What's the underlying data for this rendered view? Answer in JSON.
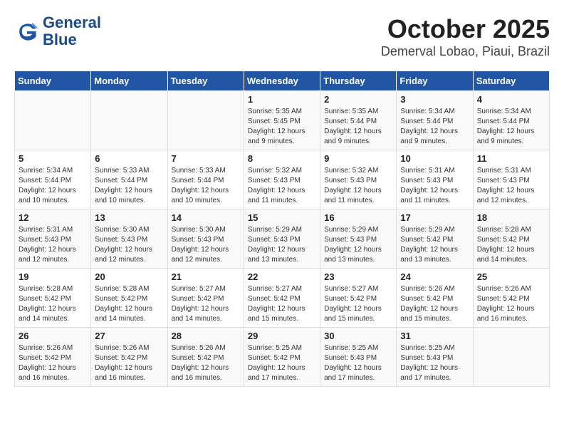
{
  "header": {
    "logo_line1": "General",
    "logo_line2": "Blue",
    "month": "October 2025",
    "location": "Demerval Lobao, Piaui, Brazil"
  },
  "weekdays": [
    "Sunday",
    "Monday",
    "Tuesday",
    "Wednesday",
    "Thursday",
    "Friday",
    "Saturday"
  ],
  "weeks": [
    [
      {
        "day": "",
        "info": ""
      },
      {
        "day": "",
        "info": ""
      },
      {
        "day": "",
        "info": ""
      },
      {
        "day": "1",
        "info": "Sunrise: 5:35 AM\nSunset: 5:45 PM\nDaylight: 12 hours and 9 minutes."
      },
      {
        "day": "2",
        "info": "Sunrise: 5:35 AM\nSunset: 5:44 PM\nDaylight: 12 hours and 9 minutes."
      },
      {
        "day": "3",
        "info": "Sunrise: 5:34 AM\nSunset: 5:44 PM\nDaylight: 12 hours and 9 minutes."
      },
      {
        "day": "4",
        "info": "Sunrise: 5:34 AM\nSunset: 5:44 PM\nDaylight: 12 hours and 9 minutes."
      }
    ],
    [
      {
        "day": "5",
        "info": "Sunrise: 5:34 AM\nSunset: 5:44 PM\nDaylight: 12 hours and 10 minutes."
      },
      {
        "day": "6",
        "info": "Sunrise: 5:33 AM\nSunset: 5:44 PM\nDaylight: 12 hours and 10 minutes."
      },
      {
        "day": "7",
        "info": "Sunrise: 5:33 AM\nSunset: 5:44 PM\nDaylight: 12 hours and 10 minutes."
      },
      {
        "day": "8",
        "info": "Sunrise: 5:32 AM\nSunset: 5:43 PM\nDaylight: 12 hours and 11 minutes."
      },
      {
        "day": "9",
        "info": "Sunrise: 5:32 AM\nSunset: 5:43 PM\nDaylight: 12 hours and 11 minutes."
      },
      {
        "day": "10",
        "info": "Sunrise: 5:31 AM\nSunset: 5:43 PM\nDaylight: 12 hours and 11 minutes."
      },
      {
        "day": "11",
        "info": "Sunrise: 5:31 AM\nSunset: 5:43 PM\nDaylight: 12 hours and 12 minutes."
      }
    ],
    [
      {
        "day": "12",
        "info": "Sunrise: 5:31 AM\nSunset: 5:43 PM\nDaylight: 12 hours and 12 minutes."
      },
      {
        "day": "13",
        "info": "Sunrise: 5:30 AM\nSunset: 5:43 PM\nDaylight: 12 hours and 12 minutes."
      },
      {
        "day": "14",
        "info": "Sunrise: 5:30 AM\nSunset: 5:43 PM\nDaylight: 12 hours and 12 minutes."
      },
      {
        "day": "15",
        "info": "Sunrise: 5:29 AM\nSunset: 5:43 PM\nDaylight: 12 hours and 13 minutes."
      },
      {
        "day": "16",
        "info": "Sunrise: 5:29 AM\nSunset: 5:43 PM\nDaylight: 12 hours and 13 minutes."
      },
      {
        "day": "17",
        "info": "Sunrise: 5:29 AM\nSunset: 5:42 PM\nDaylight: 12 hours and 13 minutes."
      },
      {
        "day": "18",
        "info": "Sunrise: 5:28 AM\nSunset: 5:42 PM\nDaylight: 12 hours and 14 minutes."
      }
    ],
    [
      {
        "day": "19",
        "info": "Sunrise: 5:28 AM\nSunset: 5:42 PM\nDaylight: 12 hours and 14 minutes."
      },
      {
        "day": "20",
        "info": "Sunrise: 5:28 AM\nSunset: 5:42 PM\nDaylight: 12 hours and 14 minutes."
      },
      {
        "day": "21",
        "info": "Sunrise: 5:27 AM\nSunset: 5:42 PM\nDaylight: 12 hours and 14 minutes."
      },
      {
        "day": "22",
        "info": "Sunrise: 5:27 AM\nSunset: 5:42 PM\nDaylight: 12 hours and 15 minutes."
      },
      {
        "day": "23",
        "info": "Sunrise: 5:27 AM\nSunset: 5:42 PM\nDaylight: 12 hours and 15 minutes."
      },
      {
        "day": "24",
        "info": "Sunrise: 5:26 AM\nSunset: 5:42 PM\nDaylight: 12 hours and 15 minutes."
      },
      {
        "day": "25",
        "info": "Sunrise: 5:26 AM\nSunset: 5:42 PM\nDaylight: 12 hours and 16 minutes."
      }
    ],
    [
      {
        "day": "26",
        "info": "Sunrise: 5:26 AM\nSunset: 5:42 PM\nDaylight: 12 hours and 16 minutes."
      },
      {
        "day": "27",
        "info": "Sunrise: 5:26 AM\nSunset: 5:42 PM\nDaylight: 12 hours and 16 minutes."
      },
      {
        "day": "28",
        "info": "Sunrise: 5:26 AM\nSunset: 5:42 PM\nDaylight: 12 hours and 16 minutes."
      },
      {
        "day": "29",
        "info": "Sunrise: 5:25 AM\nSunset: 5:42 PM\nDaylight: 12 hours and 17 minutes."
      },
      {
        "day": "30",
        "info": "Sunrise: 5:25 AM\nSunset: 5:43 PM\nDaylight: 12 hours and 17 minutes."
      },
      {
        "day": "31",
        "info": "Sunrise: 5:25 AM\nSunset: 5:43 PM\nDaylight: 12 hours and 17 minutes."
      },
      {
        "day": "",
        "info": ""
      }
    ]
  ]
}
